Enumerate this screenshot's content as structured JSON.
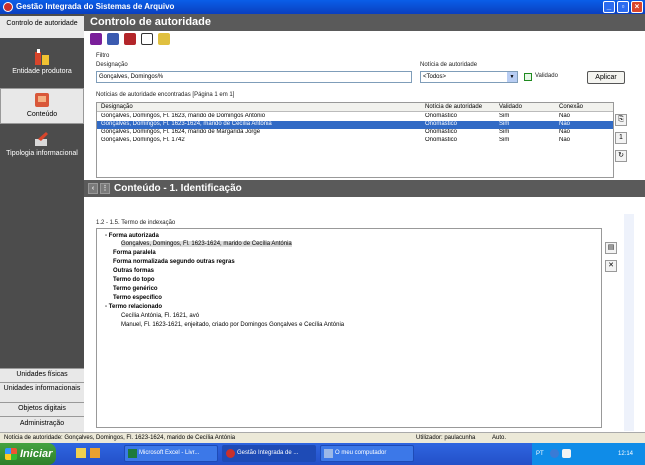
{
  "window": {
    "title": "Gestão Integrada do Sistemas de Arquivo"
  },
  "sidebar": {
    "items": [
      {
        "label": "Controlo de autoridade"
      },
      {
        "label": "Entidade produtora"
      },
      {
        "label": "Conteúdo"
      },
      {
        "label": "Tipologia informacional"
      }
    ],
    "bottom": [
      {
        "label": "Unidades físicas"
      },
      {
        "label": "Unidades informacionais"
      },
      {
        "label": "Objetos digitais"
      },
      {
        "label": "Administração"
      }
    ]
  },
  "main": {
    "heading": "Controlo de autoridade",
    "filter": {
      "label": "Filtro",
      "designation_label": "Designação",
      "designation_value": "Gonçalves, Domingos%",
      "notice_label": "Notícia de autoridade",
      "notice_value": "<Todos>",
      "validated_label": "Validado",
      "apply_label": "Aplicar"
    },
    "results_label": "Notícias de autoridade encontradas [Página 1 em 1]",
    "table": {
      "headers": [
        "Designação",
        "Notícia de autoridade",
        "Validado",
        "Conexão"
      ],
      "rows": [
        [
          "Gonçalves, Domingos, Fl. 1623, marido de Domingos António",
          "Onomástico",
          "Sim",
          "Não"
        ],
        [
          "Gonçalves, Domingos, Fl. 1623-1624, marido de Cecília Antónia",
          "Onomástico",
          "Sim",
          "Não"
        ],
        [
          "Gonçalves, Domingos, Fl. 1624, marido de Margarida Jorge",
          "Onomástico",
          "Sim",
          "Não"
        ],
        [
          "Gonçalves, Domingos, Fl. 1742",
          "Onomástico",
          "Sim",
          "Não"
        ]
      ],
      "selected_index": 1
    },
    "page_number": "1"
  },
  "content": {
    "heading": "Conteúdo - 1. Identificação",
    "section_label": "1.2 - 1.5. Termo de indexação",
    "tree": [
      {
        "text": "Forma autorizada",
        "bold": true
      },
      {
        "text": "Gonçalves, Domingos, Fl. 1623-1624, marido de Cecília Antónia",
        "bold": false
      },
      {
        "text": "Forma paralela",
        "bold": true
      },
      {
        "text": "Forma normalizada segundo outras regras",
        "bold": true
      },
      {
        "text": "Outras formas",
        "bold": true
      },
      {
        "text": "Termo do topo",
        "bold": true
      },
      {
        "text": "Termo genérico",
        "bold": true
      },
      {
        "text": "Termo específico",
        "bold": true
      },
      {
        "text": "Termo relacionado",
        "bold": true
      },
      {
        "text": "Cecília Antónia, Fl. 1621, avó",
        "bold": false
      },
      {
        "text": "Manuel, Fl. 1623-1621, enjeitado, criado por Domingos Gonçalves e Cecília Antónia",
        "bold": false
      }
    ]
  },
  "statusbar": {
    "record": "Notícia de autoridade: Gonçalves, Domingos, Fl. 1623-1624, marido de Cecília Antónia",
    "user": "Utilizador: paulacunha",
    "mode": "Auto."
  },
  "taskbar": {
    "start_label": "Iniciar",
    "tasks": [
      {
        "label": "Microsoft Excel - Livr..."
      },
      {
        "label": "Gestão Integrada de ..."
      },
      {
        "label": "O meu computador"
      }
    ],
    "tray_lang": "PT",
    "clock": "12:14"
  },
  "colors": {
    "selection": "#316ac5",
    "panel_header": "#5a5a5a",
    "sidebar_bg": "#4c4c4c",
    "taskbar": "#2350c8",
    "start_button": "#2d7f2a"
  }
}
